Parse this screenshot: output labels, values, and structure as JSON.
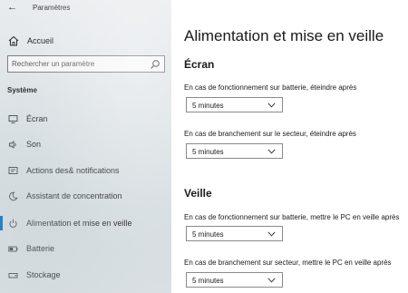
{
  "app": {
    "title": "Paramètres"
  },
  "sidebar": {
    "home_label": "Accueil",
    "search_placeholder": "Rechercher un paramètre",
    "section": "Système",
    "items": [
      {
        "label": "Écran",
        "icon": "monitor-icon"
      },
      {
        "label": "Son",
        "icon": "speaker-icon"
      },
      {
        "label": "Actions des& notifications",
        "icon": "notification-icon"
      },
      {
        "label": "Assistant de concentration",
        "icon": "moon-icon"
      },
      {
        "label": "Alimentation et mise en veille",
        "icon": "power-icon",
        "selected": true
      },
      {
        "label": "Batterie",
        "icon": "battery-icon"
      },
      {
        "label": "Stockage",
        "icon": "storage-icon"
      }
    ],
    "accent": "#0063b1"
  },
  "main": {
    "title": "Alimentation et mise en veille",
    "screen": {
      "heading": "Écran",
      "battery_label": "En cas de fonctionnement sur batterie, éteindre après",
      "battery_value": "5 minutes",
      "plugged_label": "En cas de branchement sur le secteur, éteindre après",
      "plugged_value": "5 minutes"
    },
    "sleep": {
      "heading": "Veille",
      "battery_label": "En cas de fonctionnement sur batterie, mettre le PC en veille après",
      "battery_value": "5 minutes",
      "plugged_label": "En cas de branchement sur secteur, mettre le PC en veille après",
      "plugged_value": "5 minutes"
    }
  }
}
